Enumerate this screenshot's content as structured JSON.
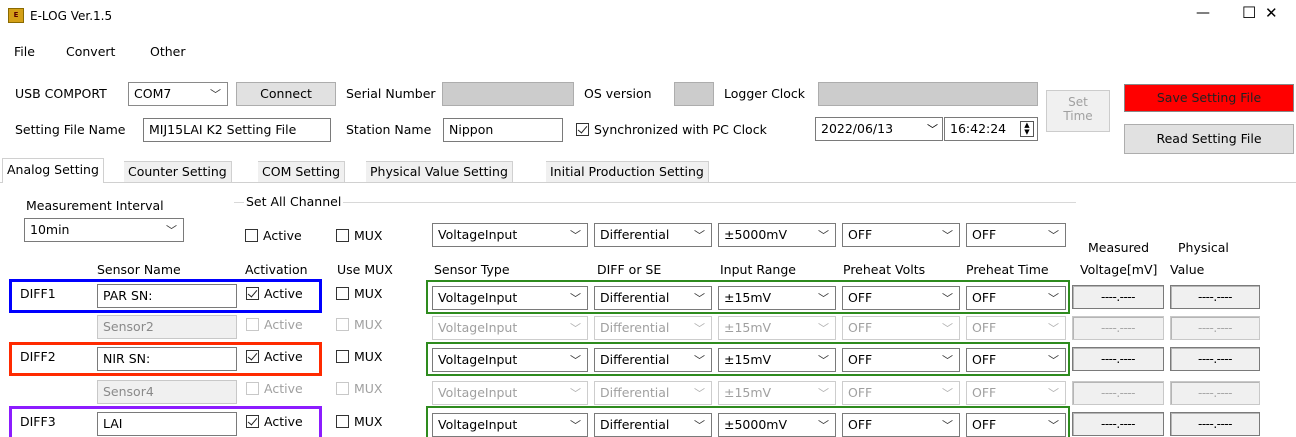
{
  "window": {
    "title": "E-LOG Ver.1.5",
    "minimize": "—",
    "maximize": "☐",
    "close": "✕"
  },
  "menu": [
    "File",
    "Convert",
    "Other"
  ],
  "header": {
    "usb_label": "USB COMPORT",
    "usb_value": "COM7",
    "connect_label": "Connect",
    "serial_label": "Serial Number",
    "os_label": "OS version",
    "clock_label": "Logger Clock",
    "set_time_label_1": "Set",
    "set_time_label_2": "Time",
    "save_label": "Save Setting File",
    "read_label": "Read Setting File",
    "setting_file_label": "Setting File Name",
    "setting_file_value": "MIJ15LAI K2 Setting File",
    "station_label": "Station Name",
    "station_value": "Nippon",
    "sync_label": "Synchronized with PC Clock",
    "date_value": "2022/06/13",
    "time_value": "16:42:24"
  },
  "tabs": [
    "Analog Setting",
    "Counter Setting",
    "COM Setting",
    "Physical Value Setting",
    "Initial Production Setting"
  ],
  "analog": {
    "interval_label": "Measurement Interval",
    "interval_value": "10min",
    "set_all_label": "Set All Channel",
    "all_active": "Active",
    "all_mux": "MUX",
    "all_type": "VoltageInput",
    "all_diff": "Differential",
    "all_range": "±5000mV",
    "all_preheat_volts": "OFF",
    "all_preheat_time": "OFF",
    "headers": {
      "sensor_name": "Sensor Name",
      "activation": "Activation",
      "use_mux": "Use MUX",
      "sensor_type": "Sensor Type",
      "diff_se": "DIFF or SE",
      "input_range": "Input Range",
      "preheat_volts": "Preheat Volts",
      "preheat_time": "Preheat Time",
      "measured_1": "Measured",
      "measured_2": "Voltage[mV]",
      "physical_1": "Physical",
      "physical_2": "Value"
    },
    "rows": [
      {
        "label": "DIFF1",
        "name": "PAR SN:",
        "active": "Active",
        "mux": "MUX",
        "type": "VoltageInput",
        "diff": "Differential",
        "range": "±15mV",
        "pv": "OFF",
        "pt": "OFF",
        "measured": "----.----",
        "physical": "----.----"
      },
      {
        "label": "",
        "name": "Sensor2",
        "active": "Active",
        "mux": "MUX",
        "type": "VoltageInput",
        "diff": "Differential",
        "range": "±15mV",
        "pv": "OFF",
        "pt": "OFF",
        "measured": "----.----",
        "physical": "----.----"
      },
      {
        "label": "DIFF2",
        "name": "NIR SN:",
        "active": "Active",
        "mux": "MUX",
        "type": "VoltageInput",
        "diff": "Differential",
        "range": "±15mV",
        "pv": "OFF",
        "pt": "OFF",
        "measured": "----.----",
        "physical": "----.----"
      },
      {
        "label": "",
        "name": "Sensor4",
        "active": "Active",
        "mux": "MUX",
        "type": "VoltageInput",
        "diff": "Differential",
        "range": "±15mV",
        "pv": "OFF",
        "pt": "OFF",
        "measured": "----.----",
        "physical": "----.----"
      },
      {
        "label": "DIFF3",
        "name": "LAI",
        "active": "Active",
        "mux": "MUX",
        "type": "VoltageInput",
        "diff": "Differential",
        "range": "±5000mV",
        "pv": "OFF",
        "pt": "OFF",
        "measured": "----.----",
        "physical": "----.----"
      }
    ]
  },
  "colors": {
    "save_button": "#ff0000",
    "diff1_outline": "#0000ff",
    "diff2_outline": "#ff2a00",
    "diff3_outline": "#8c1cff",
    "group_outline": "#2e8b1e"
  }
}
